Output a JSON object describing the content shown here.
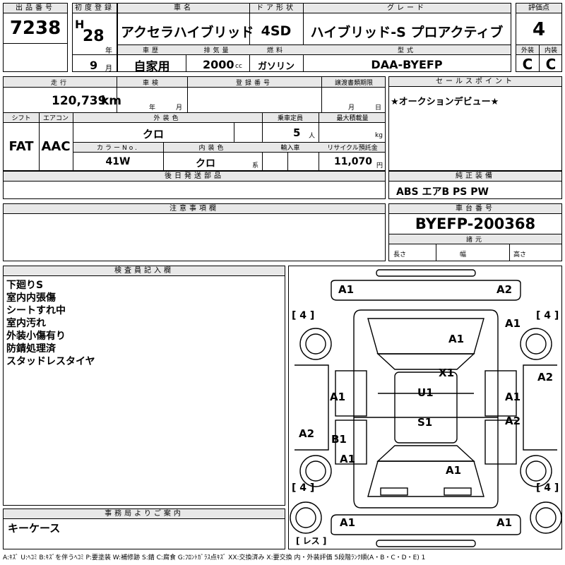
{
  "header": {
    "lot_label": "出品番号",
    "lot_number": "7238",
    "first_reg_label": "初度登録",
    "era": "H",
    "year": "28",
    "year_unit": "年",
    "month": "9",
    "month_unit": "月",
    "car_name_label": "車名",
    "car_name": "アクセラハイブリッド",
    "door_label": "ドア形状",
    "door": "4SD",
    "grade_label": "グレード",
    "grade": "ハイブリッド-S プロアクティブ",
    "score_label": "評価点",
    "score": "4",
    "history_label": "車歴",
    "history": "自家用",
    "displacement_label": "排気量",
    "displacement": "2000",
    "displacement_unit": "cc",
    "fuel_label": "燃料",
    "fuel": "ガソリン",
    "model_label": "型式",
    "model": "DAA-BYEFP",
    "exterior_label": "外装",
    "exterior": "C",
    "interior_label": "内装",
    "interior": "C"
  },
  "mid": {
    "mileage_label": "走行",
    "mileage": "120,739",
    "mileage_unit": "km",
    "inspection_label": "車検",
    "inspection_year_unit": "年",
    "inspection_month_unit": "月",
    "reg_label": "登録番号",
    "transfer_label": "譲渡書類期限",
    "transfer_month_unit": "月",
    "transfer_day_unit": "日",
    "sales_label": "セールスポイント",
    "sales_point": "★オークションデビュー★",
    "shift_label": "シフト",
    "shift": "FAT",
    "ac_label": "エアコン",
    "ac": "AAC",
    "color_label": "外装色",
    "color": "クロ",
    "seats_label": "乗車定員",
    "seats": "5",
    "seats_unit": "人",
    "load_label": "最大積載量",
    "load_unit": "kg",
    "color_no_label": "カラーNo.",
    "color_no": "41W",
    "int_color_label": "内装色",
    "int_color": "クロ",
    "int_color_unit": "系",
    "import_label": "輸入車",
    "recycle_label": "リサイクル預託金",
    "recycle": "11,070",
    "recycle_unit": "円",
    "later_parts_label": "後日発送部品",
    "equipment_label": "純正装備",
    "equipment": "ABS エアB PS PW",
    "notes_label": "注意事項欄",
    "chassis_label": "車台番号",
    "chassis": "BYEFP-200368",
    "specs_label": "諸元",
    "length_label": "長さ",
    "width_label": "幅",
    "height_label": "高さ"
  },
  "inspector": {
    "label": "検査員記入欄",
    "lines": [
      "下廻りS",
      "室内内張傷",
      "シートすれ中",
      "室内汚れ",
      "外装小傷有り",
      "防錆処理済",
      "スタッドレスタイヤ"
    ]
  },
  "office": {
    "label": "事務局よりご案内",
    "text": "キーケース"
  },
  "diagram": {
    "marks": [
      "A1",
      "A2",
      "A1",
      "A1",
      "X1",
      "A1",
      "U1",
      "A1",
      "A2",
      "A2",
      "B1",
      "S1",
      "A2",
      "A1",
      "A1",
      "A1",
      "A1"
    ],
    "tire": "4",
    "spare_label": "レス"
  },
  "legend": "A:ｷｽﾞ U:ﾍｺﾐ B:ｷｽﾞを伴うﾍｺﾐ P:要塗装 W:補修跡 S:錆 C:腐食 G:ﾌﾛﾝﾄｶﾞﾗｽ点ｷｽﾞ XX:交換済み X:要交換 内・外装評価 5段階ﾗﾝｸ順(A・B・C・D・E) 1"
}
